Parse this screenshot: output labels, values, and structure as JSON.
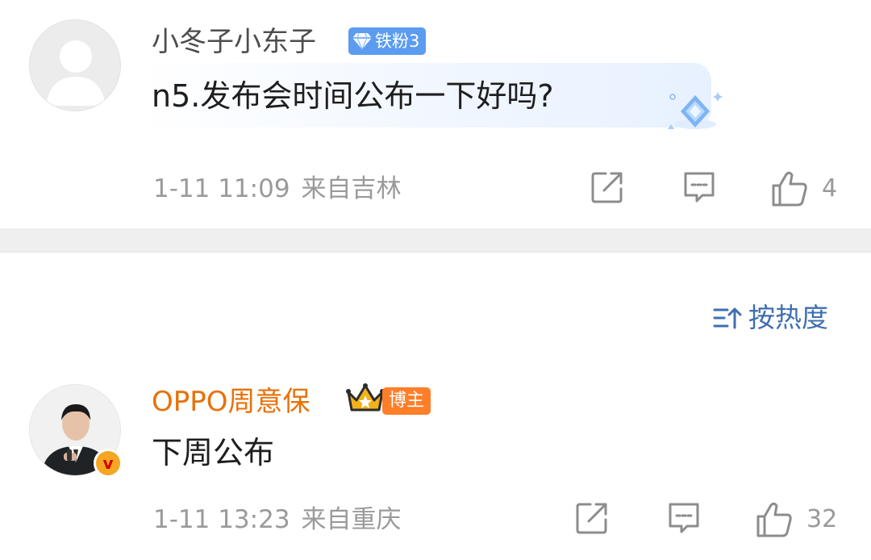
{
  "comments": [
    {
      "username": "小冬子小东子",
      "fan_badge": "铁粉3",
      "text": "n5.发布会时间公布一下好吗?",
      "date": "1-11 11:09",
      "location": "来自吉林",
      "likes": "4"
    },
    {
      "username": "OPPO周意保",
      "owner_badge": "博主",
      "verified_mark": "v",
      "text": "下周公布",
      "date": "1-11 13:23",
      "location": "来自重庆",
      "likes": "32"
    }
  ],
  "sort": {
    "label": "按热度"
  },
  "colors": {
    "accent_blue": "#3f6fb0",
    "fan_badge_bg": "#5b9cf0",
    "owner_name": "#e8710a",
    "owner_badge_bg": "#ff7e29",
    "meta_gray": "#9a9a9a"
  },
  "icons": [
    "share-icon",
    "comment-icon",
    "like-icon",
    "sort-icon",
    "diamond-icon",
    "crown-icon",
    "verified-icon",
    "default-avatar-icon"
  ]
}
